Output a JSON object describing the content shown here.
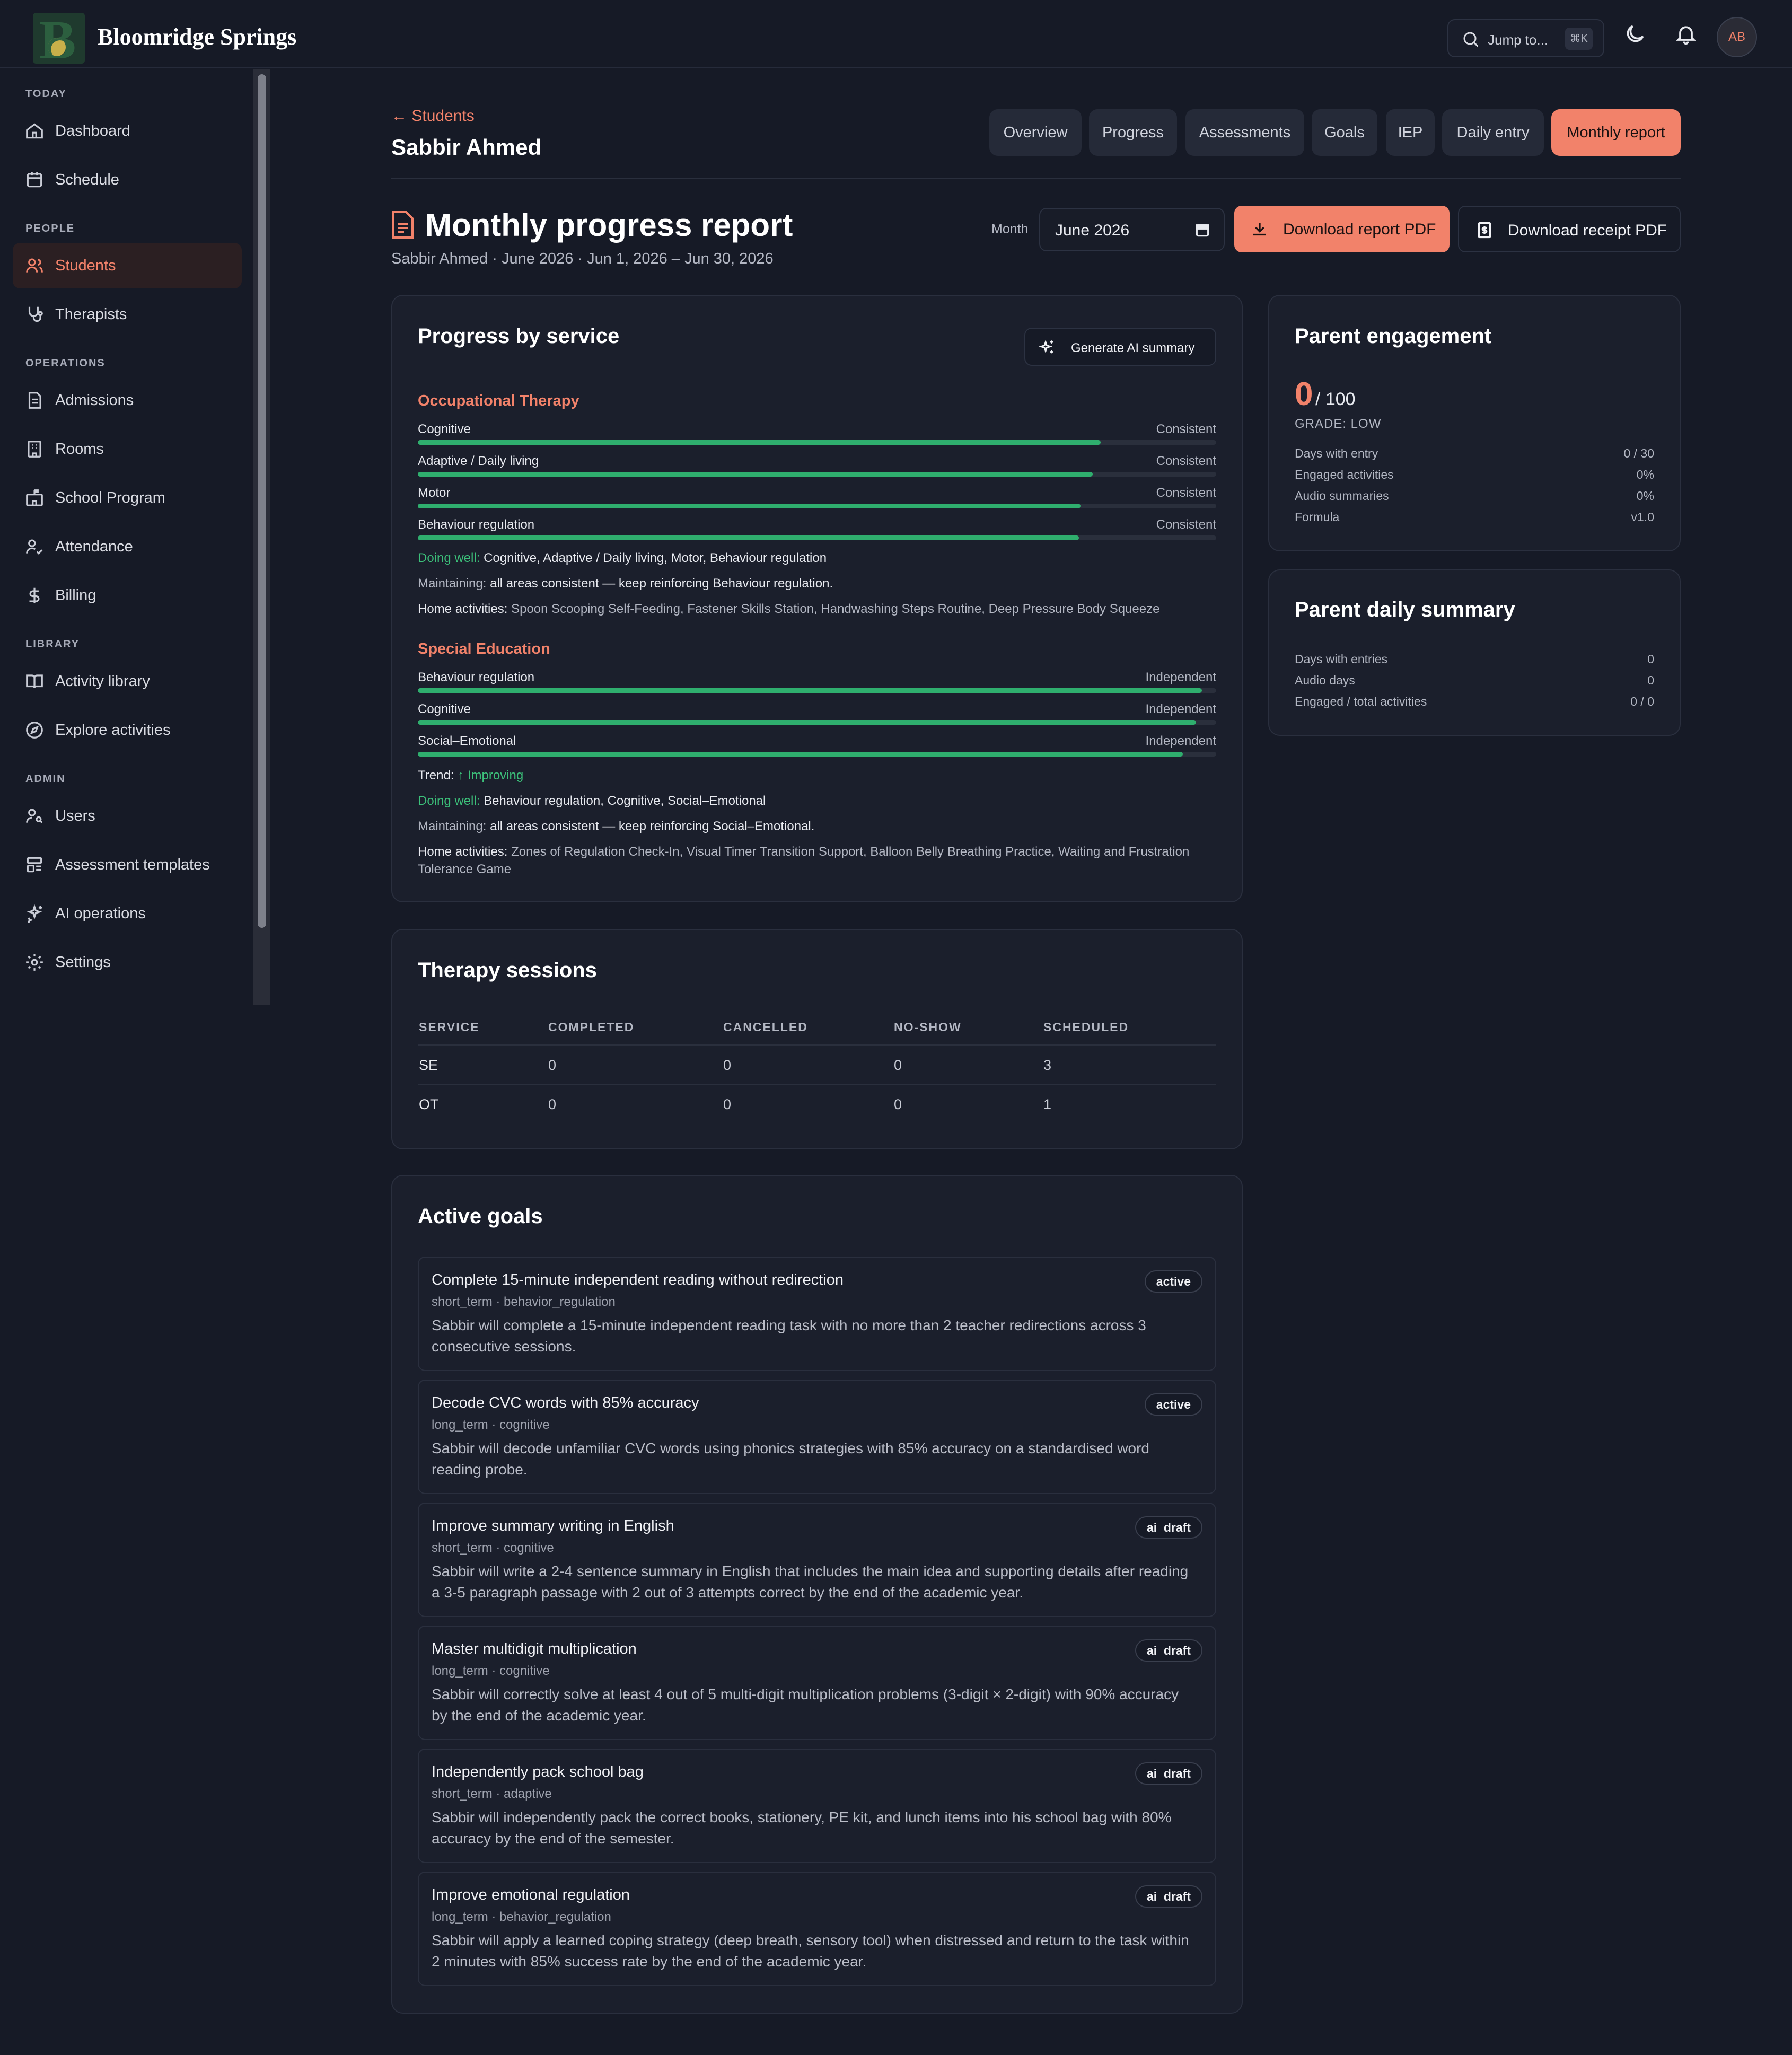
{
  "brand": {
    "name": "Bloomridge Springs"
  },
  "topbar": {
    "search_placeholder": "Jump to...",
    "search_shortcut": "⌘K",
    "avatar_initials": "AB"
  },
  "sidebar": {
    "sections": [
      "TODAY",
      "PEOPLE",
      "OPERATIONS",
      "LIBRARY",
      "ADMIN"
    ],
    "items": [
      {
        "label": "Dashboard",
        "icon": "home-icon"
      },
      {
        "label": "Schedule",
        "icon": "calendar-icon"
      },
      {
        "label": "Students",
        "icon": "users-icon",
        "active": true
      },
      {
        "label": "Therapists",
        "icon": "stethoscope-icon"
      },
      {
        "label": "Admissions",
        "icon": "document-icon"
      },
      {
        "label": "Rooms",
        "icon": "building-icon"
      },
      {
        "label": "School Program",
        "icon": "school-icon"
      },
      {
        "label": "Attendance",
        "icon": "user-check-icon"
      },
      {
        "label": "Billing",
        "icon": "dollar-icon"
      },
      {
        "label": "Activity library",
        "icon": "book-icon"
      },
      {
        "label": "Explore activities",
        "icon": "compass-icon"
      },
      {
        "label": "Users",
        "icon": "user-key-icon"
      },
      {
        "label": "Assessment templates",
        "icon": "template-icon"
      },
      {
        "label": "AI operations",
        "icon": "sparkles-icon"
      },
      {
        "label": "Settings",
        "icon": "gear-icon"
      }
    ]
  },
  "header": {
    "back_label": "Students",
    "student_name": "Sabbir Ahmed",
    "tabs": [
      "Overview",
      "Progress",
      "Assessments",
      "Goals",
      "IEP",
      "Daily entry",
      "Monthly report"
    ],
    "active_tab": "Monthly report"
  },
  "report": {
    "title": "Monthly progress report",
    "subtitle": "Sabbir Ahmed · June 2026 · Jun 1, 2026 – Jun 30, 2026",
    "month_label": "Month",
    "month_value": "June 2026",
    "download_report": "Download report PDF",
    "download_receipt": "Download receipt PDF"
  },
  "progress": {
    "title": "Progress by service",
    "generate_label": "Generate AI summary",
    "services": [
      {
        "name": "Occupational Therapy",
        "bars": [
          {
            "label": "Cognitive",
            "status": "Consistent",
            "level": 0.855
          },
          {
            "label": "Adaptive / Daily living",
            "status": "Consistent",
            "level": 0.845
          },
          {
            "label": "Motor",
            "status": "Consistent",
            "level": 0.83
          },
          {
            "label": "Behaviour regulation",
            "status": "Consistent",
            "level": 0.828
          }
        ],
        "doing_well_label": "Doing well:",
        "doing_well": "Cognitive, Adaptive / Daily living, Motor, Behaviour regulation",
        "maintaining_label": "Maintaining:",
        "maintaining": "all areas consistent — keep reinforcing Behaviour regulation.",
        "home_label": "Home activities:",
        "home": "Spoon Scooping Self-Feeding, Fastener Skills Station, Handwashing Steps Routine, Deep Pressure Body Squeeze"
      },
      {
        "name": "Special Education",
        "bars": [
          {
            "label": "Behaviour regulation",
            "status": "Independent",
            "level": 0.982
          },
          {
            "label": "Cognitive",
            "status": "Independent",
            "level": 0.975
          },
          {
            "label": "Social–Emotional",
            "status": "Independent",
            "level": 0.958
          }
        ],
        "trend_label": "Trend:",
        "trend": "↑ Improving",
        "doing_well_label": "Doing well:",
        "doing_well": "Behaviour regulation, Cognitive, Social–Emotional",
        "maintaining_label": "Maintaining:",
        "maintaining": "all areas consistent — keep reinforcing Social–Emotional.",
        "home_label": "Home activities:",
        "home": "Zones of Regulation Check-In, Visual Timer Transition Support, Balloon Belly Breathing Practice, Waiting and Frustration Tolerance Game"
      }
    ]
  },
  "sessions": {
    "title": "Therapy sessions",
    "columns": [
      "SERVICE",
      "COMPLETED",
      "CANCELLED",
      "NO-SHOW",
      "SCHEDULED"
    ],
    "rows": [
      [
        "SE",
        "0",
        "0",
        "0",
        "3"
      ],
      [
        "OT",
        "0",
        "0",
        "0",
        "1"
      ]
    ]
  },
  "goals": {
    "title": "Active goals",
    "items": [
      {
        "title": "Complete 15-minute independent reading without redirection",
        "meta": "short_term · behavior_regulation",
        "desc": "Sabbir will complete a 15-minute independent reading task with no more than 2 teacher redirections across 3 consecutive sessions.",
        "badge": "active"
      },
      {
        "title": "Decode CVC words with 85% accuracy",
        "meta": "long_term · cognitive",
        "desc": "Sabbir will decode unfamiliar CVC words using phonics strategies with 85% accuracy on a standardised word reading probe.",
        "badge": "active"
      },
      {
        "title": "Improve summary writing in English",
        "meta": "short_term · cognitive",
        "desc": "Sabbir will write a 2-4 sentence summary in English that includes the main idea and supporting details after reading a 3-5 paragraph passage with 2 out of 3 attempts correct by the end of the academic year.",
        "badge": "ai_draft"
      },
      {
        "title": "Master multidigit multiplication",
        "meta": "long_term · cognitive",
        "desc": "Sabbir will correctly solve at least 4 out of 5 multi-digit multiplication problems (3-digit × 2-digit) with 90% accuracy by the end of the academic year.",
        "badge": "ai_draft"
      },
      {
        "title": "Independently pack school bag",
        "meta": "short_term · adaptive",
        "desc": "Sabbir will independently pack the correct books, stationery, PE kit, and lunch items into his school bag with 80% accuracy by the end of the semester.",
        "badge": "ai_draft"
      },
      {
        "title": "Improve emotional regulation",
        "meta": "long_term · behavior_regulation",
        "desc": "Sabbir will apply a learned coping strategy (deep breath, sensory tool) when distressed and return to the task within 2 minutes with 85% success rate by the end of the academic year.",
        "badge": "ai_draft"
      }
    ]
  },
  "engagement": {
    "title": "Parent engagement",
    "score": "0",
    "score_max": "/ 100",
    "grade": "GRADE: LOW",
    "rows": [
      [
        "Days with entry",
        "0 / 30"
      ],
      [
        "Engaged activities",
        "0%"
      ],
      [
        "Audio summaries",
        "0%"
      ],
      [
        "Formula",
        "v1.0"
      ]
    ]
  },
  "daily_summary": {
    "title": "Parent daily summary",
    "rows": [
      [
        "Days with entries",
        "0"
      ],
      [
        "Audio days",
        "0"
      ],
      [
        "Engaged / total activities",
        "0 / 0"
      ]
    ]
  },
  "colors": {
    "accent": "#f2826a",
    "progress": "#2fae6e",
    "background": "#161a26",
    "card": "#1b1f2c"
  }
}
